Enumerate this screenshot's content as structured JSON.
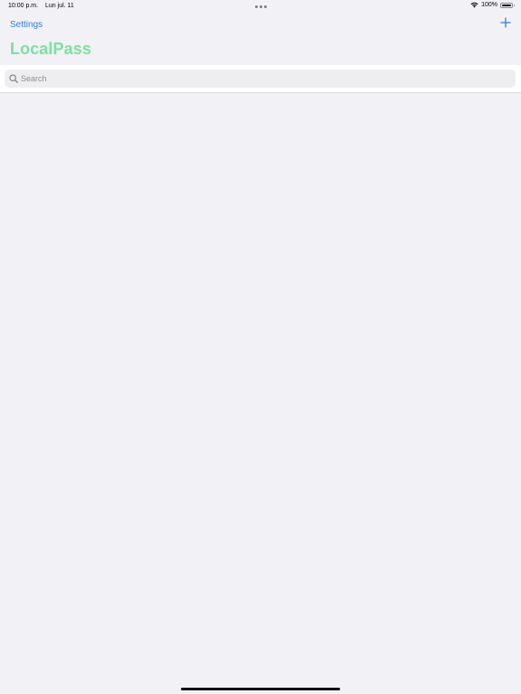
{
  "status_bar": {
    "time": "10:00 p.m.",
    "date": "Lun jul. 11",
    "battery": "100%",
    "battery_level": 1.0,
    "icons": [
      "wifi-icon",
      "battery-icon"
    ]
  },
  "nav": {
    "left_button": "Settings",
    "right_button_icon": "plus-icon",
    "title": "LocalPass"
  },
  "search": {
    "placeholder": "Search",
    "value": "",
    "icon": "search-icon"
  },
  "colors": {
    "background": "#f2f1f6",
    "accent": "#2d7ed6",
    "title": "#7ee0a0"
  }
}
